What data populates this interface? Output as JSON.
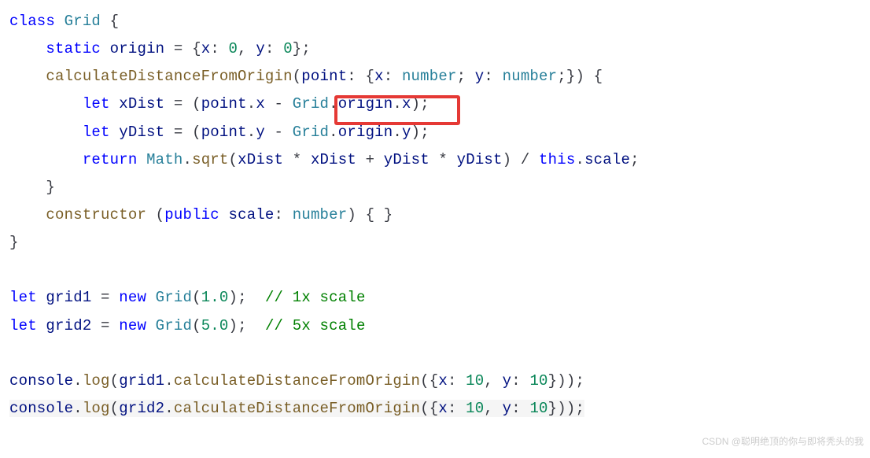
{
  "code": {
    "kw_class": "class",
    "kw_static": "static",
    "kw_let": "let",
    "kw_return": "return",
    "kw_new": "new",
    "kw_public": "public",
    "kw_this": "this",
    "type_grid": "Grid",
    "type_math": "Math",
    "type_number": "number",
    "id_origin": "origin",
    "id_x": "x",
    "id_y": "y",
    "id_point": "point",
    "id_xDist": "xDist",
    "id_yDist": "yDist",
    "id_scale": "scale",
    "id_grid1": "grid1",
    "id_grid2": "grid2",
    "id_console": "console",
    "fn_calc": "calculateDistanceFromOrigin",
    "fn_sqrt": "sqrt",
    "fn_ctor": "constructor",
    "fn_log": "log",
    "num_0a": "0",
    "num_0b": "0",
    "num_1f": "1.0",
    "num_5f": "5.0",
    "num_10a": "10",
    "num_10b": "10",
    "num_10c": "10",
    "num_10d": "10",
    "cmt_1x": "// 1x scale",
    "cmt_5x": "// 5x scale"
  },
  "watermark": "CSDN @聪明绝顶的你与即将秃头的我"
}
